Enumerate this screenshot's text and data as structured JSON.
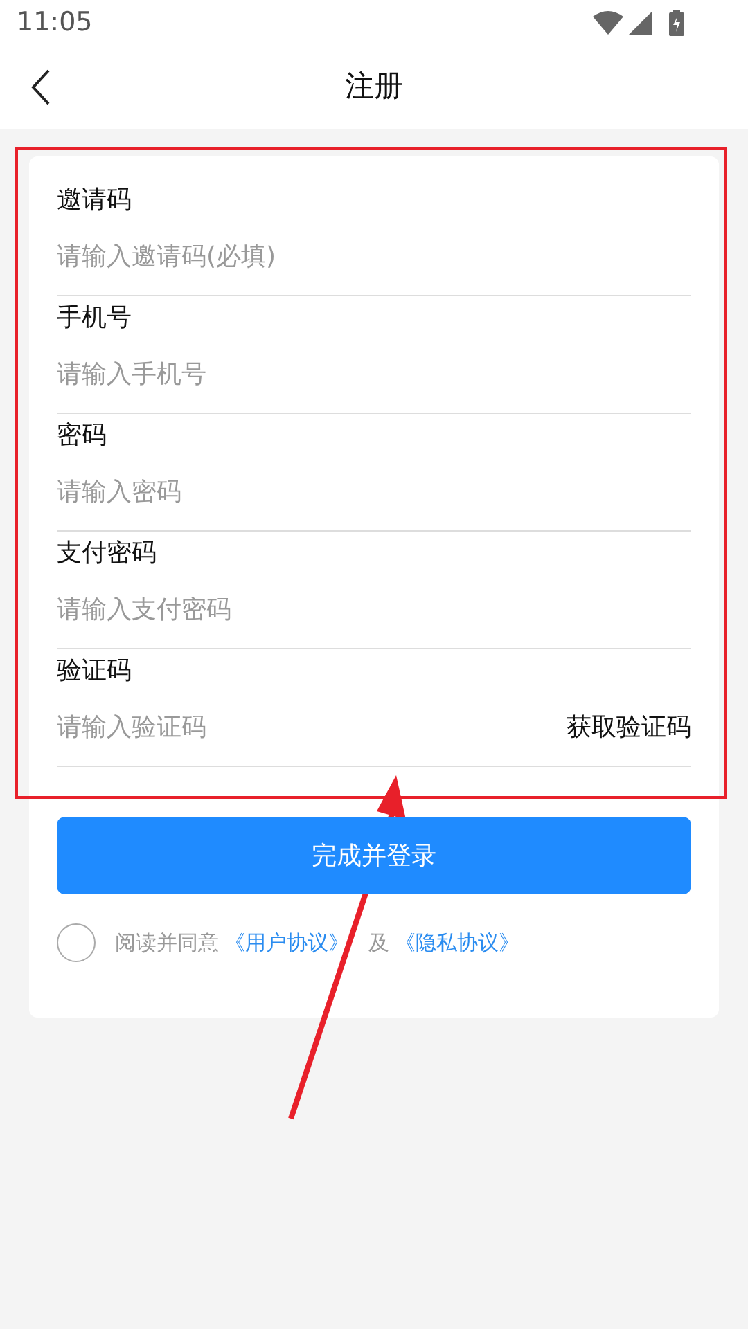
{
  "status_bar": {
    "time": "11:05"
  },
  "header": {
    "title": "注册"
  },
  "fields": [
    {
      "label": "邀请码",
      "placeholder": "请输入邀请码(必填)"
    },
    {
      "label": "手机号",
      "placeholder": "请输入手机号"
    },
    {
      "label": "密码",
      "placeholder": "请输入密码"
    },
    {
      "label": "支付密码",
      "placeholder": "请输入支付密码"
    },
    {
      "label": "验证码",
      "placeholder": "请输入验证码",
      "action": "获取验证码"
    }
  ],
  "submit_button": "完成并登录",
  "agreement": {
    "checked": false,
    "text": "阅读并同意",
    "links": [
      "《用户协议》",
      "《隐私协议》"
    ],
    "joiner": "及"
  }
}
